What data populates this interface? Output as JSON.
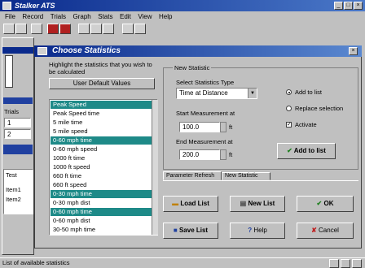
{
  "app": {
    "title": "Stalker ATS"
  },
  "menu": [
    "File",
    "Record",
    "Trials",
    "Graph",
    "Stats",
    "Edit",
    "View",
    "Help"
  ],
  "dialog": {
    "title": "Choose Statistics",
    "instructions": "Highlight the statistics that you wish to be calculated",
    "default_button": "User Default Values",
    "stats_list": [
      {
        "label": "Peak Speed",
        "selected": true
      },
      {
        "label": "Peak Speed time",
        "selected": false
      },
      {
        "label": "5 mile time",
        "selected": false
      },
      {
        "label": "5 mile speed",
        "selected": false
      },
      {
        "label": "0-60 mph time",
        "selected": true
      },
      {
        "label": "0-60 mph speed",
        "selected": false
      },
      {
        "label": "1000 ft time",
        "selected": false
      },
      {
        "label": "1000 ft speed",
        "selected": false
      },
      {
        "label": "660 ft time",
        "selected": false
      },
      {
        "label": "660 ft speed",
        "selected": false
      },
      {
        "label": "0-30 mph time",
        "selected": true
      },
      {
        "label": "0-30 mph dist",
        "selected": false
      },
      {
        "label": "0-60 mph time",
        "selected": true
      },
      {
        "label": "0-60 mph dist",
        "selected": false
      },
      {
        "label": "30-50 mph time",
        "selected": false
      }
    ],
    "new_statistic": {
      "group_label": "New Statistic",
      "type_label": "Select Statistics Type",
      "type_value": "Time at Distance",
      "start_label": "Start Measurement at",
      "start_value": "100.0",
      "start_unit": "ft",
      "end_label": "End Measurement at",
      "end_value": "200.0",
      "end_unit": "ft",
      "add_to_list_radio": "Add to list",
      "replace_radio": "Replace selection",
      "activate_checkbox": "Activate",
      "add_button": "Add to list"
    },
    "tabs": [
      "Parameter Refresh",
      "New Statistic"
    ],
    "buttons": {
      "load": "Load List",
      "new": "New List",
      "ok": "OK",
      "save": "Save List",
      "help": "Help",
      "cancel": "Cancel"
    }
  },
  "bg": {
    "left_labels": [
      "Trials",
      "1",
      "2",
      "Test",
      "Item1",
      "Item2"
    ]
  },
  "status": {
    "text": "List of available statistics"
  },
  "colors": {
    "selection": "#1e8a88",
    "title": "#0a2a8c"
  }
}
